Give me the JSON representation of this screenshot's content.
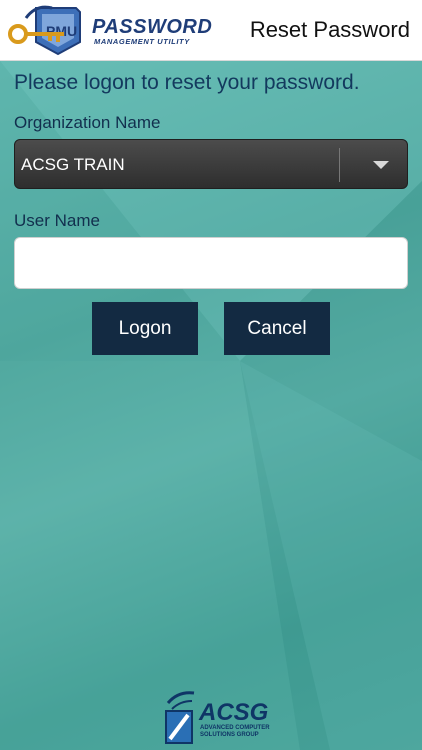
{
  "header": {
    "logo_title": "PASSWORD",
    "logo_subtitle": "MANAGEMENT UTILITY",
    "title": "Reset Password"
  },
  "form": {
    "prompt": "Please logon to reset your password.",
    "org_label": "Organization Name",
    "org_value": "ACSG TRAIN",
    "user_label": "User Name",
    "user_value": "",
    "logon_label": "Logon",
    "cancel_label": "Cancel"
  },
  "footer": {
    "brand": "ACSG",
    "brand_sub": "ADVANCED COMPUTER SOLUTIONS GROUP"
  },
  "colors": {
    "background": "#5fb5ad",
    "button": "#132a42",
    "select": "#3c3c3c",
    "brand": "#1f3d78"
  },
  "icons": {
    "logo": "key-shield-logo-icon",
    "dropdown": "chevron-down-icon",
    "footer": "acsg-logo-icon"
  }
}
